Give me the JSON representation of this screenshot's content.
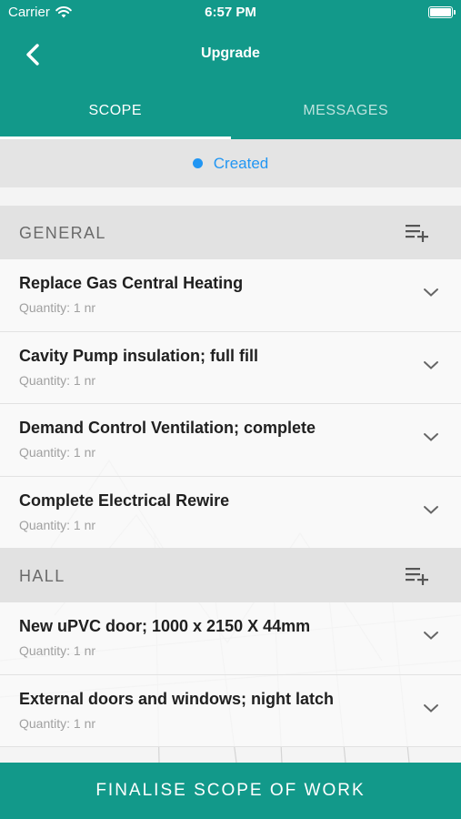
{
  "status_bar": {
    "carrier": "Carrier",
    "time": "6:57 PM"
  },
  "nav": {
    "title": "Upgrade"
  },
  "tabs": [
    {
      "label": "SCOPE",
      "active": true
    },
    {
      "label": "MESSAGES",
      "active": false
    }
  ],
  "status": {
    "label": "Created",
    "color": "#2196f3"
  },
  "sections": [
    {
      "title": "GENERAL",
      "items": [
        {
          "title": "Replace Gas Central Heating",
          "quantity": "Quantity: 1 nr"
        },
        {
          "title": "Cavity Pump insulation; full fill",
          "quantity": "Quantity: 1 nr"
        },
        {
          "title": "Demand Control Ventilation; complete",
          "quantity": "Quantity: 1 nr"
        },
        {
          "title": "Complete Electrical Rewire",
          "quantity": "Quantity: 1 nr"
        }
      ]
    },
    {
      "title": "HALL",
      "items": [
        {
          "title": "New uPVC door; 1000 x 2150 X 44mm",
          "quantity": "Quantity: 1 nr"
        },
        {
          "title": "External doors and windows; night latch",
          "quantity": "Quantity: 1 nr"
        }
      ]
    }
  ],
  "footer": {
    "label": "FINALISE SCOPE OF WORK"
  },
  "colors": {
    "primary": "#12998a",
    "status_blue": "#2196f3",
    "section_bg": "#e2e2e2"
  },
  "icons": {
    "back": "chevron-left-icon",
    "section_add": "playlist-add-icon",
    "item_expand": "chevron-down-icon",
    "wifi": "wifi-icon",
    "battery": "battery-icon"
  }
}
